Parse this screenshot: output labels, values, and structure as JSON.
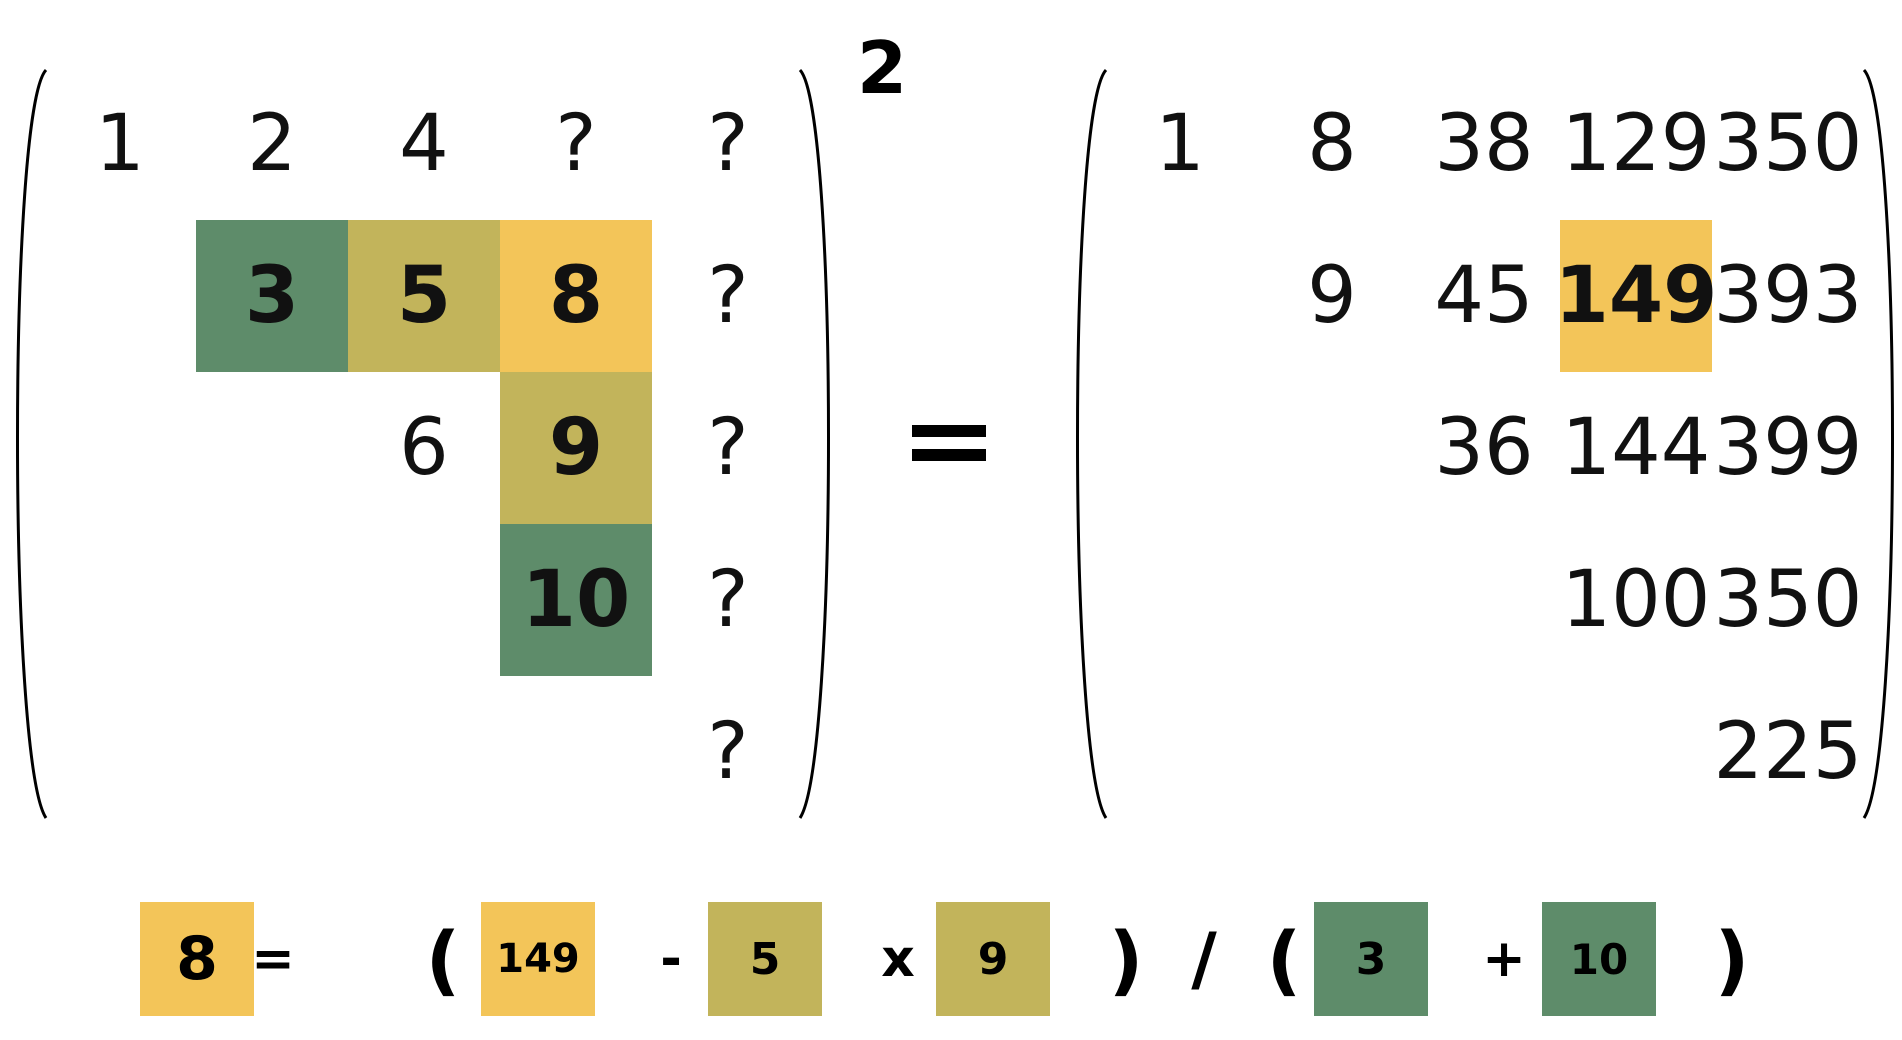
{
  "colors": {
    "yellow": "#F3C559",
    "olive": "#C2B45B",
    "green": "#5E8C6A"
  },
  "left_matrix": {
    "exponent": "2",
    "rows": [
      [
        {
          "text": "1"
        },
        {
          "text": "2"
        },
        {
          "text": "4"
        },
        {
          "text": "?"
        },
        {
          "text": "?"
        }
      ],
      [
        {
          "text": ""
        },
        {
          "text": "3",
          "highlight": "green",
          "bold": true
        },
        {
          "text": "5",
          "highlight": "olive",
          "bold": true
        },
        {
          "text": "8",
          "highlight": "yellow",
          "bold": true
        },
        {
          "text": "?"
        }
      ],
      [
        {
          "text": ""
        },
        {
          "text": ""
        },
        {
          "text": "6"
        },
        {
          "text": "9",
          "highlight": "olive",
          "bold": true
        },
        {
          "text": "?"
        }
      ],
      [
        {
          "text": ""
        },
        {
          "text": ""
        },
        {
          "text": ""
        },
        {
          "text": "10",
          "highlight": "green",
          "bold": true
        },
        {
          "text": "?"
        }
      ],
      [
        {
          "text": ""
        },
        {
          "text": ""
        },
        {
          "text": ""
        },
        {
          "text": ""
        },
        {
          "text": "?"
        }
      ]
    ]
  },
  "equals_sign": "=",
  "right_matrix": {
    "rows": [
      [
        {
          "text": "1"
        },
        {
          "text": "8"
        },
        {
          "text": "38"
        },
        {
          "text": "129"
        },
        {
          "text": "350"
        }
      ],
      [
        {
          "text": ""
        },
        {
          "text": "9"
        },
        {
          "text": "45"
        },
        {
          "text": "149",
          "highlight": "yellow",
          "bold": true
        },
        {
          "text": "393"
        }
      ],
      [
        {
          "text": ""
        },
        {
          "text": ""
        },
        {
          "text": "36"
        },
        {
          "text": "144"
        },
        {
          "text": "399"
        }
      ],
      [
        {
          "text": ""
        },
        {
          "text": ""
        },
        {
          "text": ""
        },
        {
          "text": "100"
        },
        {
          "text": "350"
        }
      ],
      [
        {
          "text": ""
        },
        {
          "text": ""
        },
        {
          "text": ""
        },
        {
          "text": ""
        },
        {
          "text": "225"
        }
      ]
    ]
  },
  "equation": [
    {
      "kind": "tile",
      "text": "8",
      "color": "yellow"
    },
    {
      "kind": "op",
      "text": "="
    },
    {
      "kind": "op",
      "text": "("
    },
    {
      "kind": "tile",
      "text": "149",
      "color": "yellow"
    },
    {
      "kind": "op",
      "text": "-"
    },
    {
      "kind": "tile",
      "text": "5",
      "color": "olive"
    },
    {
      "kind": "op",
      "text": "x"
    },
    {
      "kind": "tile",
      "text": "9",
      "color": "olive"
    },
    {
      "kind": "op",
      "text": ")"
    },
    {
      "kind": "op",
      "text": "/"
    },
    {
      "kind": "op",
      "text": "("
    },
    {
      "kind": "tile",
      "text": "3",
      "color": "green"
    },
    {
      "kind": "op",
      "text": "+"
    },
    {
      "kind": "tile",
      "text": "10",
      "color": "green"
    },
    {
      "kind": "op",
      "text": ")"
    }
  ]
}
